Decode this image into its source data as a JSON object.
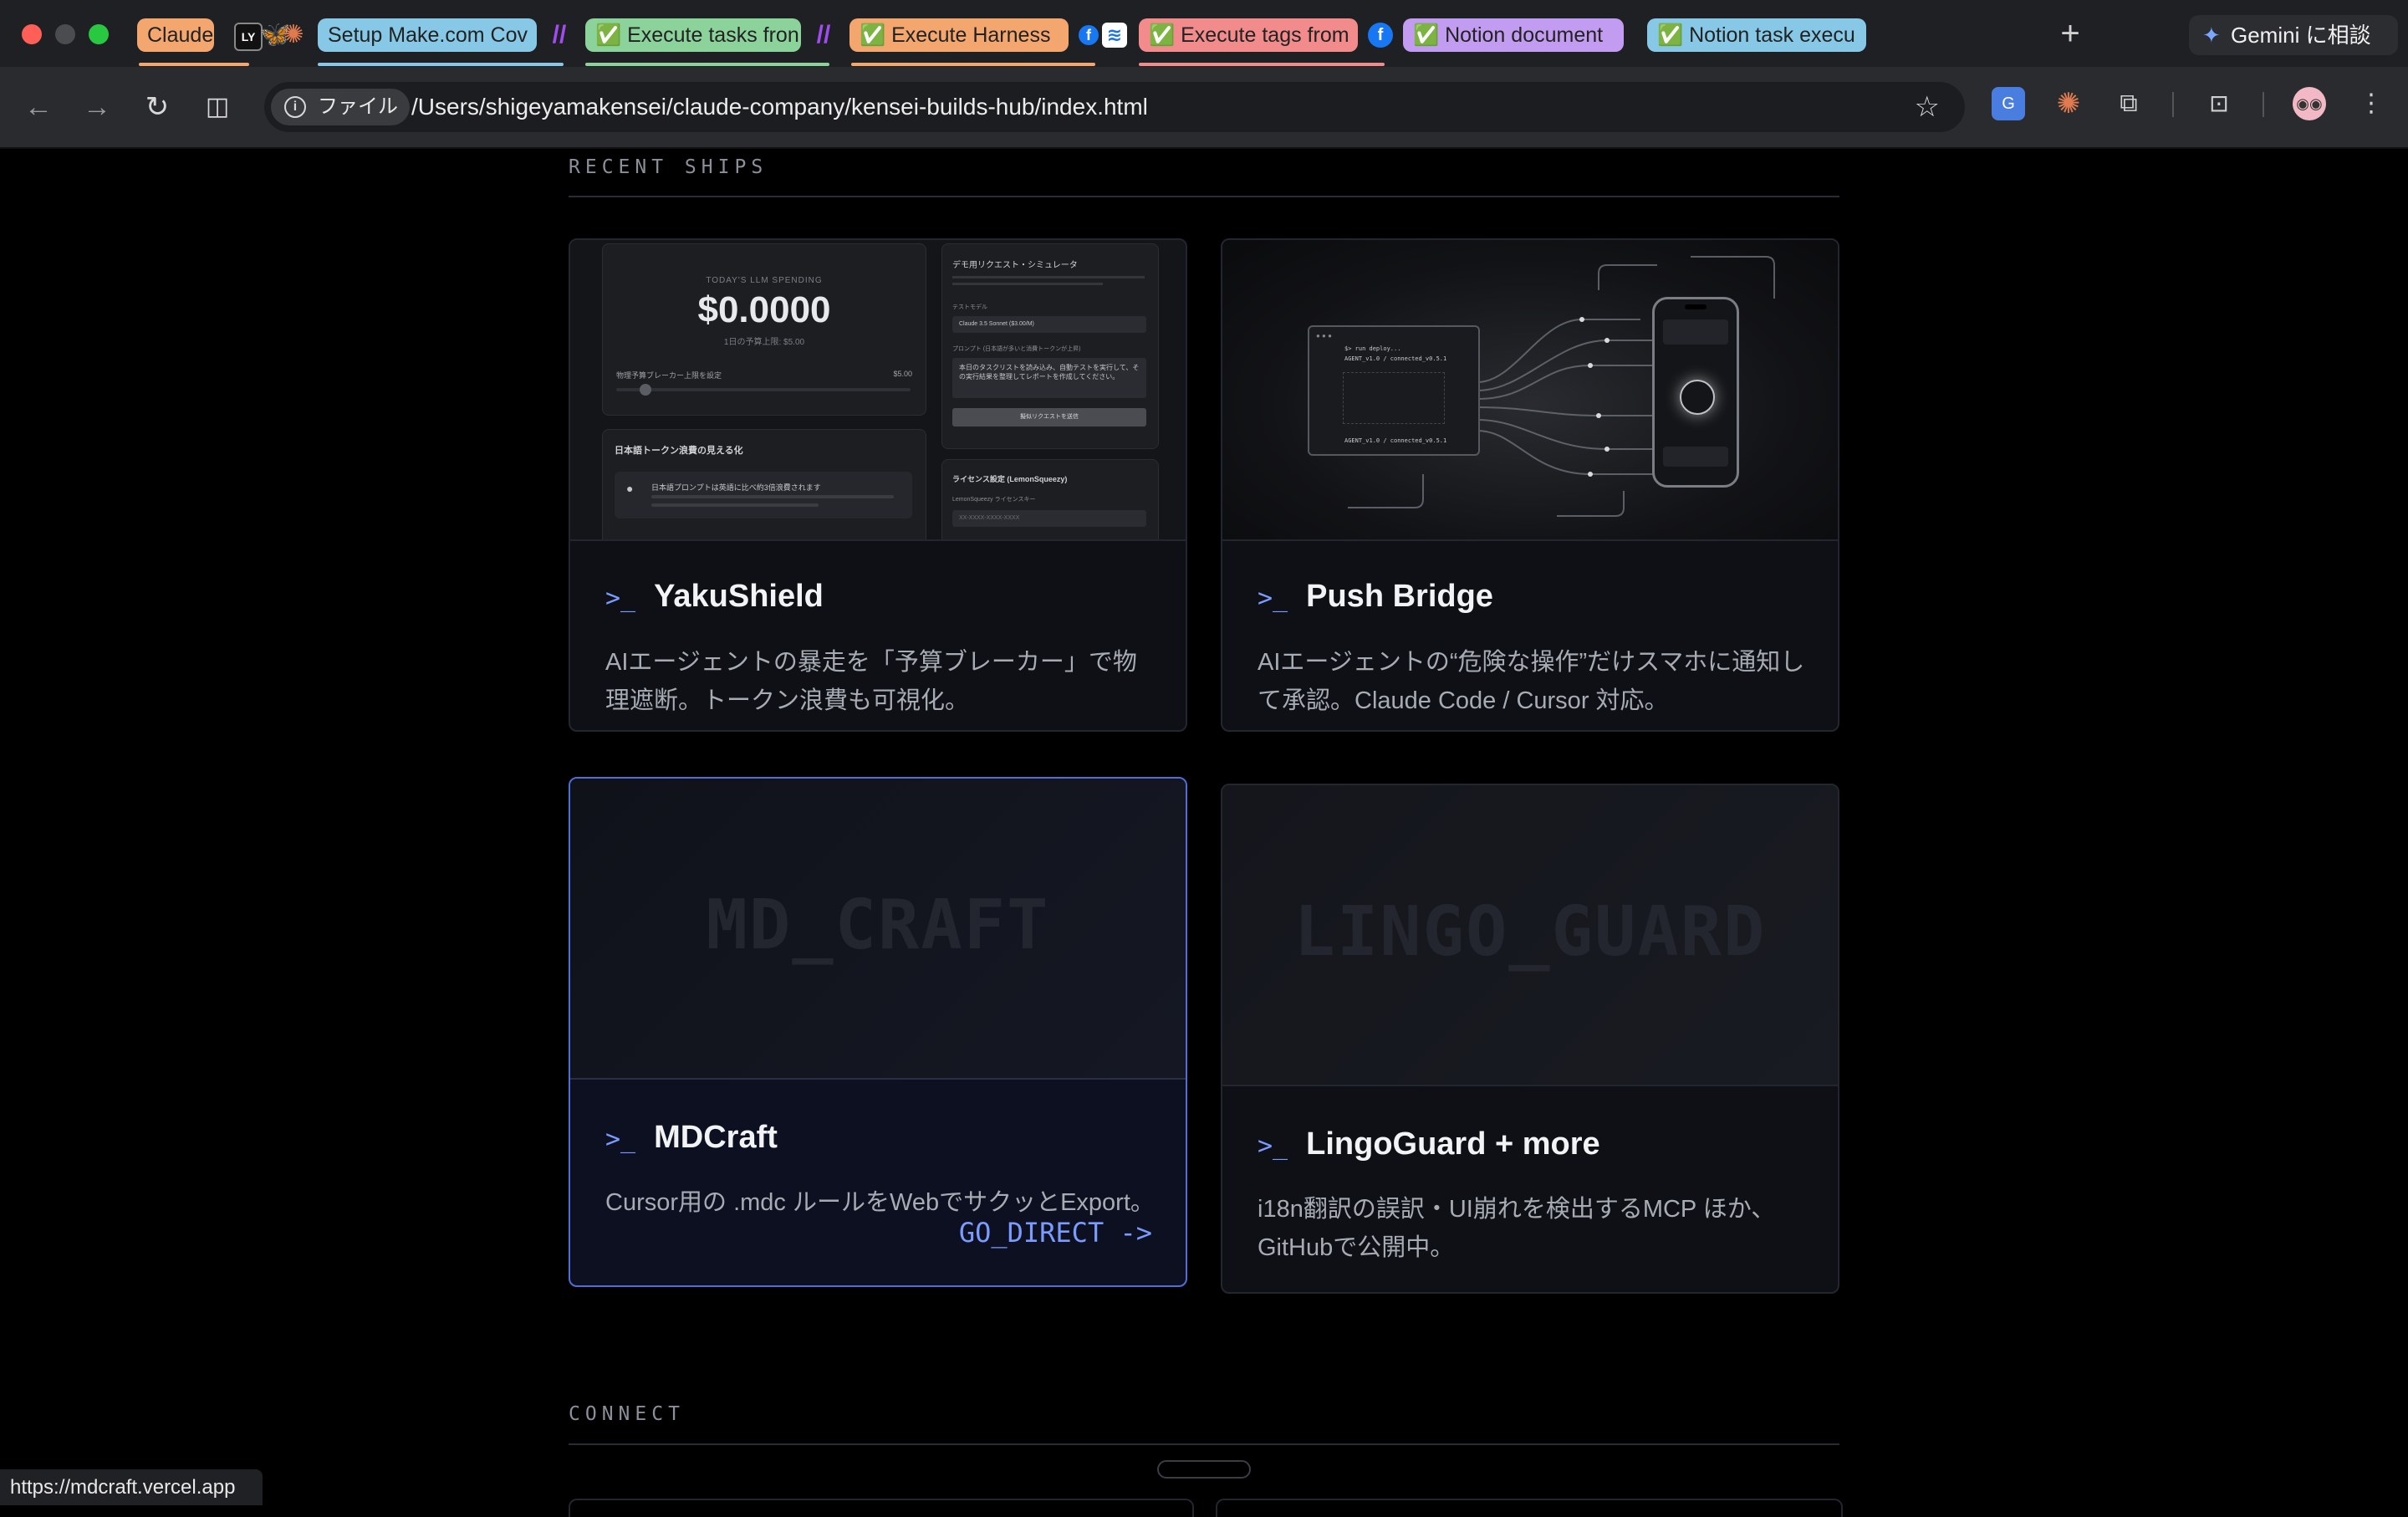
{
  "browser": {
    "tabs": [
      {
        "label": "Claude",
        "color": "#f4a66f"
      },
      {
        "label": "Setup Make.com Cov",
        "color": "#86c8e6"
      },
      {
        "label": "✅ Execute tasks fron",
        "color": "#8bd39b"
      },
      {
        "label": "✅ Execute Harness",
        "color": "#f4a66f"
      },
      {
        "label": "✅ Execute tags from",
        "color": "#f28b8b"
      },
      {
        "label": "✅ Notion document",
        "color": "#c29cf0"
      },
      {
        "label": "✅ Notion task execu",
        "color": "#86c8e6"
      }
    ],
    "gemini_label": "Gemini に相談",
    "site_chip": "ファイル",
    "url": "/Users/shigeyamakensei/claude-company/kensei-builds-hub/index.html",
    "status_url": "https://mdcraft.vercel.app"
  },
  "sections": {
    "recent_ships": "RECENT SHIPS",
    "connect": "CONNECT"
  },
  "cards": [
    {
      "prompt": ">_",
      "title": "YakuShield",
      "desc": "AIエージェントの暴走を「予算ブレーカー」で物理遮断。トークン浪費も可視化。",
      "thumb": {
        "spending_label": "TODAY'S LLM SPENDING",
        "spending_value": "$0.0000",
        "daily_limit": "1日の予算上限: $5.00",
        "breaker_label": "物理予算ブレーカー上限を設定",
        "breaker_value": "$5.00",
        "token_title": "日本語トークン浪費の見える化",
        "token_note": "日本語プロンプトは英語に比べ約3倍浪費されます",
        "sim_title": "デモ用リクエスト・シミュレータ",
        "sim_model_label": "テストモデル",
        "sim_model": "Claude 3.5 Sonnet ($3.00/M)",
        "sim_prompt_label": "プロンプト (日本語が多いと消費トークンが上昇)",
        "sim_prompt": "本日のタスクリストを読み込み、自動テストを実行して、その実行結果を整理してレポートを作成してください。",
        "sim_button": "擬似リクエストを送信",
        "license_title": "ライセンス設定 (LemonSqueezy)",
        "license_label": "LemonSqueezy ライセンスキー",
        "license_placeholder": "XX-XXXX-XXXX-XXXX"
      }
    },
    {
      "prompt": ">_",
      "title": "Push Bridge",
      "desc": "AIエージェントの“危険な操作”だけスマホに通知して承認。Claude Code / Cursor 対応。",
      "thumb": {
        "terminal_line1": "$> run deploy...",
        "terminal_line2": "AGENT_v1.0 / connected_v0.5.1",
        "terminal_line3": "AGENT_v1.0 / connected_v0.5.1"
      }
    },
    {
      "prompt": ">_",
      "title": "MDCraft",
      "desc": "Cursor用の .mdc ルールをWebでサクッとExport。",
      "placeholder": "MD_CRAFT",
      "go_direct": "GO_DIRECT ->"
    },
    {
      "prompt": ">_",
      "title": "LingoGuard + more",
      "desc": "i18n翻訳の誤訳・UI崩れを検出するMCP ほか、GitHubで公開中。",
      "placeholder": "LINGO_GUARD"
    }
  ]
}
